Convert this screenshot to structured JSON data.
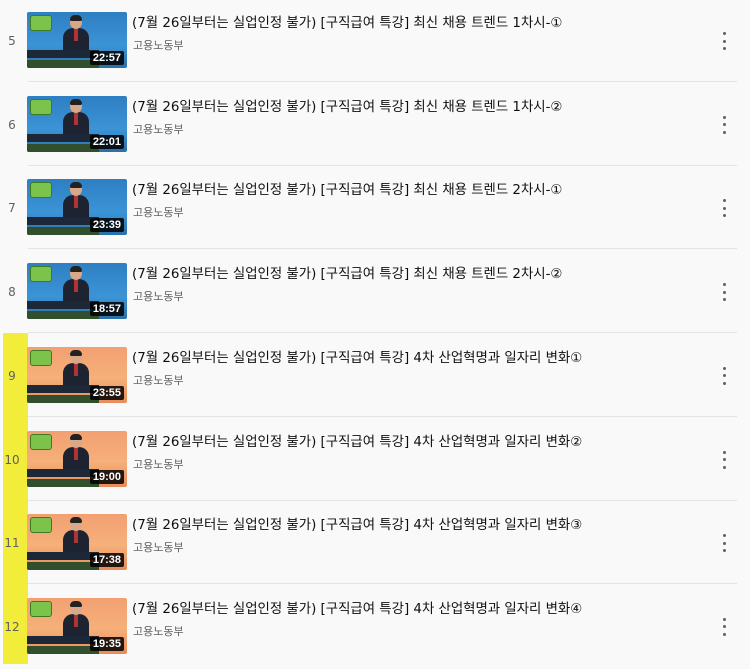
{
  "playlist": {
    "items": [
      {
        "index": "5",
        "title": "(7월 26일부터는 실업인정 불가) [구직급여 특강] 최신 채용 트렌드 1차시-①",
        "channel": "고용노동부",
        "duration": "22:57",
        "theme": "blue"
      },
      {
        "index": "6",
        "title": "(7월 26일부터는 실업인정 불가) [구직급여 특강] 최신 채용 트렌드 1차시-②",
        "channel": "고용노동부",
        "duration": "22:01",
        "theme": "blue"
      },
      {
        "index": "7",
        "title": "(7월 26일부터는 실업인정 불가) [구직급여 특강] 최신 채용 트렌드 2차시-①",
        "channel": "고용노동부",
        "duration": "23:39",
        "theme": "blue"
      },
      {
        "index": "8",
        "title": "(7월 26일부터는 실업인정 불가) [구직급여 특강] 최신 채용 트렌드 2차시-②",
        "channel": "고용노동부",
        "duration": "18:57",
        "theme": "blue"
      },
      {
        "index": "9",
        "title": "(7월 26일부터는 실업인정 불가) [구직급여 특강] 4차 산업혁명과 일자리 변화①",
        "channel": "고용노동부",
        "duration": "23:55",
        "theme": "orange"
      },
      {
        "index": "10",
        "title": "(7월 26일부터는 실업인정 불가) [구직급여 특강] 4차 산업혁명과 일자리 변화②",
        "channel": "고용노동부",
        "duration": "19:00",
        "theme": "orange"
      },
      {
        "index": "11",
        "title": "(7월 26일부터는 실업인정 불가) [구직급여 특강] 4차 산업혁명과 일자리 변화③",
        "channel": "고용노동부",
        "duration": "17:38",
        "theme": "orange"
      },
      {
        "index": "12",
        "title": "(7월 26일부터는 실업인정 불가) [구직급여 특강] 4차 산업혁명과 일자리 변화④",
        "channel": "고용노동부",
        "duration": "19:35",
        "theme": "orange"
      }
    ]
  },
  "colors": {
    "highlight": "#f2ec3a",
    "background": "#f9f9f9",
    "duration_badge": "#000000"
  },
  "icons": {
    "menu": "more-vert-icon"
  }
}
